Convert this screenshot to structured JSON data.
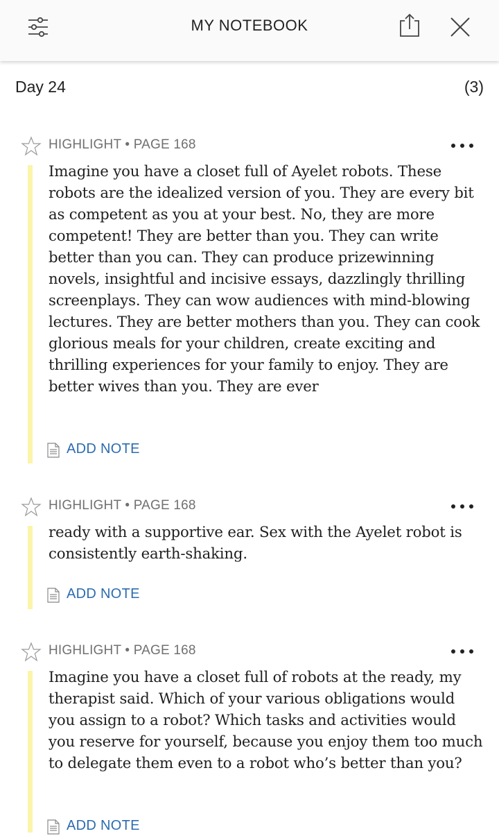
{
  "header": {
    "title": "MY NOTEBOOK",
    "filter_icon": "filter-sliders-icon",
    "share_icon": "share-icon",
    "close_icon": "close-icon"
  },
  "section": {
    "title": "Day 24",
    "count": "(3)"
  },
  "highlights": [
    {
      "label": "HIGHLIGHT • PAGE 168",
      "text": "Imagine you have a closet full of Ayelet robots. These robots are the idealized version of you. They are every bit as competent as you at your best. No, they are more competent! They are better than you. They can write better than you can. They can produce prizewinning novels, insightful and incisive essays, dazzlingly thrilling screenplays. They can wow audiences with mind-blowing lectures. They are better mothers than you. They can cook glorious meals for your children, create exciting and thrilling experiences for your family to enjoy. They are better wives than you. They are ever",
      "add_note": "ADD NOTE"
    },
    {
      "label": "HIGHLIGHT • PAGE 168",
      "text": "ready with a supportive ear. Sex with the Ayelet robot is consistently earth-shaking.",
      "add_note": "ADD NOTE"
    },
    {
      "label": "HIGHLIGHT • PAGE 168",
      "text": "Imagine you have a closet full of robots at the ready, my therapist said. Which of your various obligations would you assign to a robot? Which tasks and activities would you reserve for yourself, because you enjoy them too much to delegate them even to a robot who’s better than you?",
      "add_note": "ADD NOTE"
    }
  ],
  "colors": {
    "highlight_bar": "#fbf4a9",
    "link": "#2c6bb0",
    "meta": "#707070"
  }
}
